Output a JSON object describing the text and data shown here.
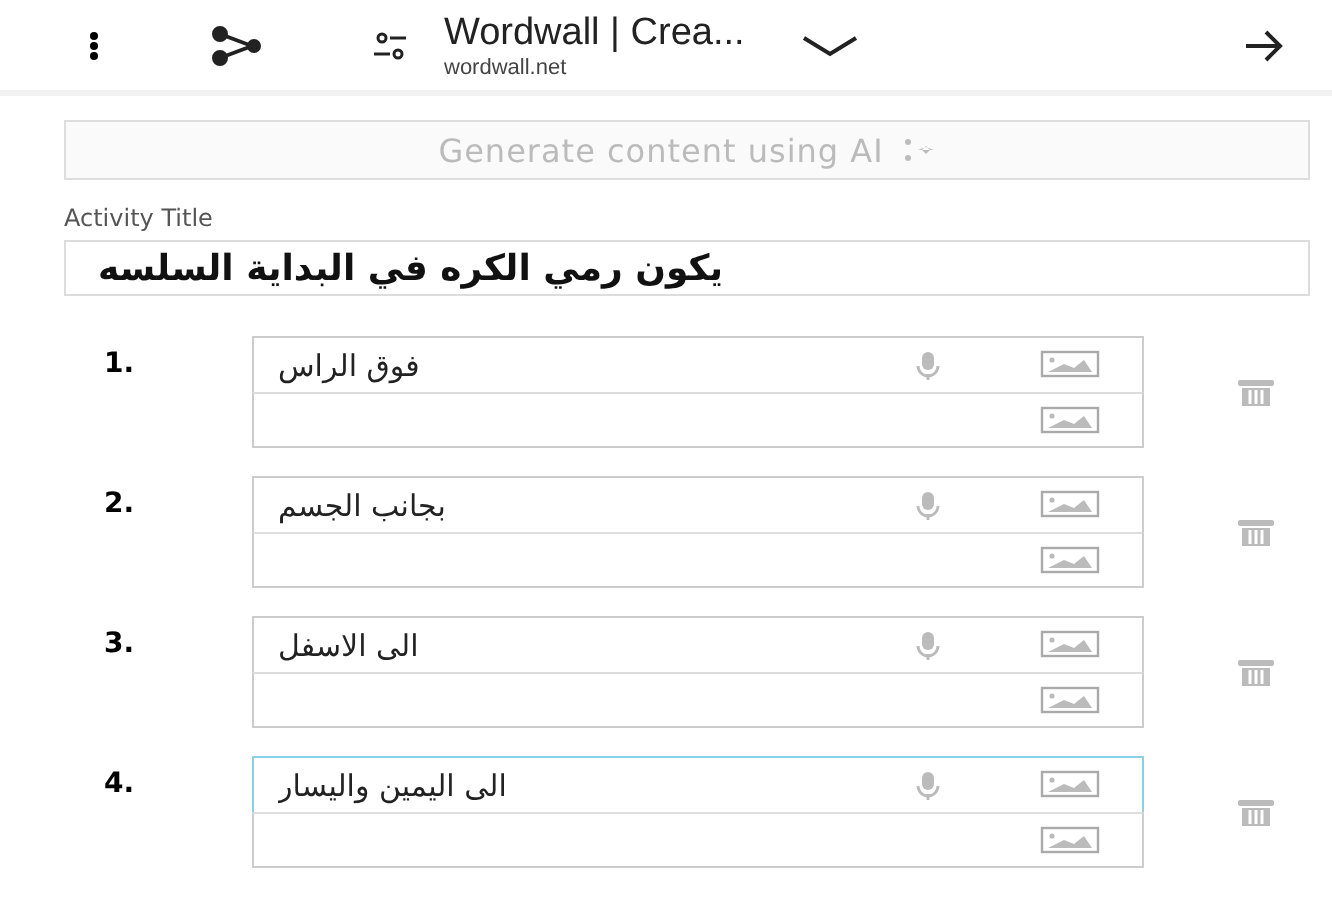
{
  "browser_bar": {
    "title": "Wordwall | Crea...",
    "url": "wordwall.net"
  },
  "generate_button": {
    "label": "Generate content using AI",
    "disabled": true
  },
  "activity_title": {
    "label": "Activity Title",
    "value": "يكون رمي الكره في البداية السلسه"
  },
  "items": [
    {
      "number": "1.",
      "text": "فوق الراس",
      "focused": false
    },
    {
      "number": "2.",
      "text": "بجانب الجسم",
      "focused": false
    },
    {
      "number": "3.",
      "text": "الى الاسفل",
      "focused": false
    },
    {
      "number": "4.",
      "text": "الى اليمين واليسار",
      "focused": true
    }
  ]
}
